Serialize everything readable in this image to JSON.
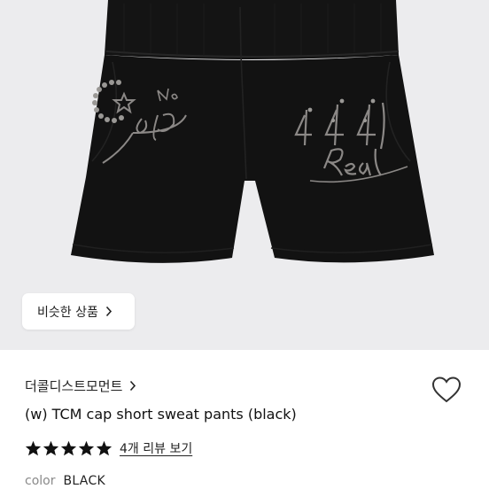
{
  "product_image": {
    "print_left": {
      "small": "No",
      "main": "cap"
    },
    "print_right": {
      "number": "444",
      "word": "Real"
    },
    "garment_color": "#121212",
    "print_color": "#8b8886"
  },
  "similar_button": {
    "label": "비슷한 상품",
    "icon": "chevron-right-icon"
  },
  "product": {
    "brand": "더콜디스트모먼트",
    "brand_icon": "chevron-right-icon",
    "title": "(w) TCM cap short sweat pants (black)",
    "rating": {
      "stars": 5,
      "max": 5
    },
    "review_label": "4개 리뷰 보기",
    "color_label": "color",
    "color_value": "BLACK",
    "wishlist_icon": "heart-outline-icon"
  }
}
